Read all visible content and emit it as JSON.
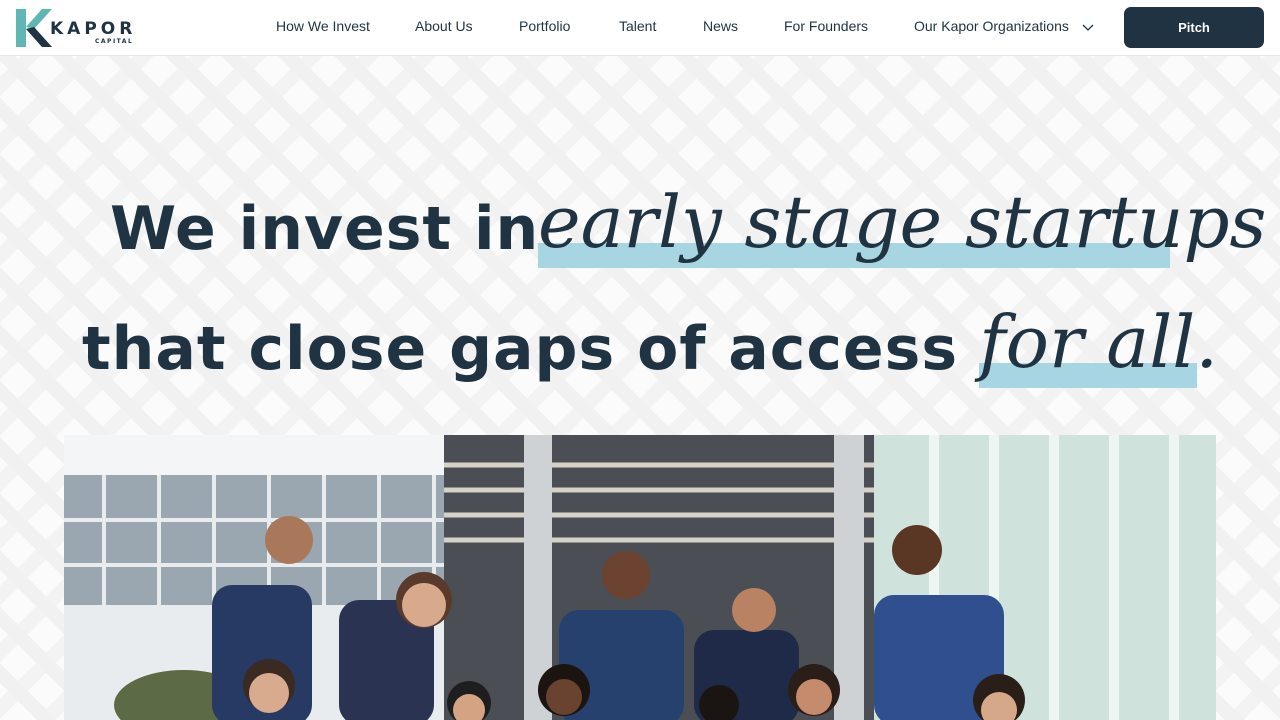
{
  "brand": {
    "name": "KAPOR",
    "sub": "CAPITAL",
    "logo_colors": {
      "teal": "#5fb7b3",
      "navy": "#1f3342"
    }
  },
  "nav": {
    "items": [
      {
        "label": "How We Invest"
      },
      {
        "label": "About Us"
      },
      {
        "label": "Portfolio"
      },
      {
        "label": "Talent"
      },
      {
        "label": "News"
      },
      {
        "label": "For Founders"
      },
      {
        "label": "Our Kapor Organizations"
      }
    ],
    "dropdown_icon": "chevron-down-icon",
    "pitch_label": "Pitch"
  },
  "hero": {
    "line1_plain": "We invest in",
    "line1_emphasis": "early stage startups",
    "line2_plain": "that close gaps of access",
    "line2_emphasis": "for all."
  },
  "colors": {
    "navy": "#1f3342",
    "highlight": "#a8d5e2",
    "button_text": "#ffffff"
  }
}
